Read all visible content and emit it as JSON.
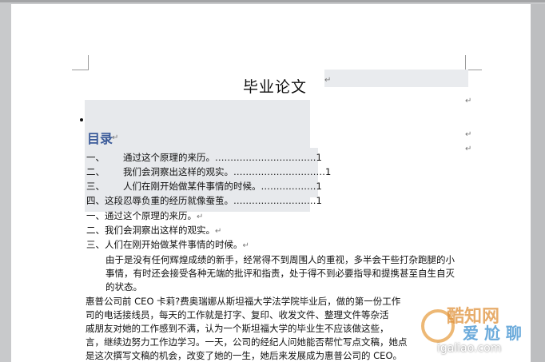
{
  "document": {
    "title": "毕业论文",
    "toc_heading": "目录",
    "toc_items": [
      {
        "num": "一、",
        "text": "通过这个原理的来历。",
        "leader": "……………………………",
        "page": "1"
      },
      {
        "num": "二、",
        "text": "我们会洞察出这样的观实。",
        "leader": "…………………………",
        "page": "1"
      },
      {
        "num": "三、",
        "text": "人们在刚开始做某件事情的时候。",
        "leader": "………………",
        "page": "1"
      },
      {
        "num": "四、",
        "text": "这段忍辱负重的经历就像蚕茧。",
        "leader": "………………………",
        "page": "1"
      }
    ],
    "headings": [
      "一、通过这个原理的来历。",
      "二、我们会洞察出这样的观实。",
      "三、人们在刚开始做某件事情的时候。"
    ],
    "para1": [
      "由于是没有任何辉煌成绩的新手，经常得不到周围人的重视，多半会干些打杂跑腿的小",
      "事情，有时还会接受各种无端的批评和指责，处于得不到必要指导和提携甚至自生自灭",
      "的状态。"
    ],
    "para2": [
      "惠普公司前 CEO 卡莉?费奥瑞娜从斯坦福大学法学院毕业后，做的第一份工作",
      "司的电话接线员，每天的工作就是打字、复印、收发文件、整理文件等杂活",
      "戚朋友对她的工作感到不满，认为一个斯坦福大学的毕业生不应该做这些，",
      "言，继续边努力工作边学习。一天，公司的经纪人问她能否帮忙写点文稿，她点",
      "是这次撰写文稿的机会，改变了她的一生，她后来发展成为惠普公司的 CEO。"
    ],
    "mark_symbol": "↵",
    "watermark": {
      "line1": "酷知网",
      "line2": "爱 尬 聊",
      "line3": "igaliao.com"
    }
  }
}
